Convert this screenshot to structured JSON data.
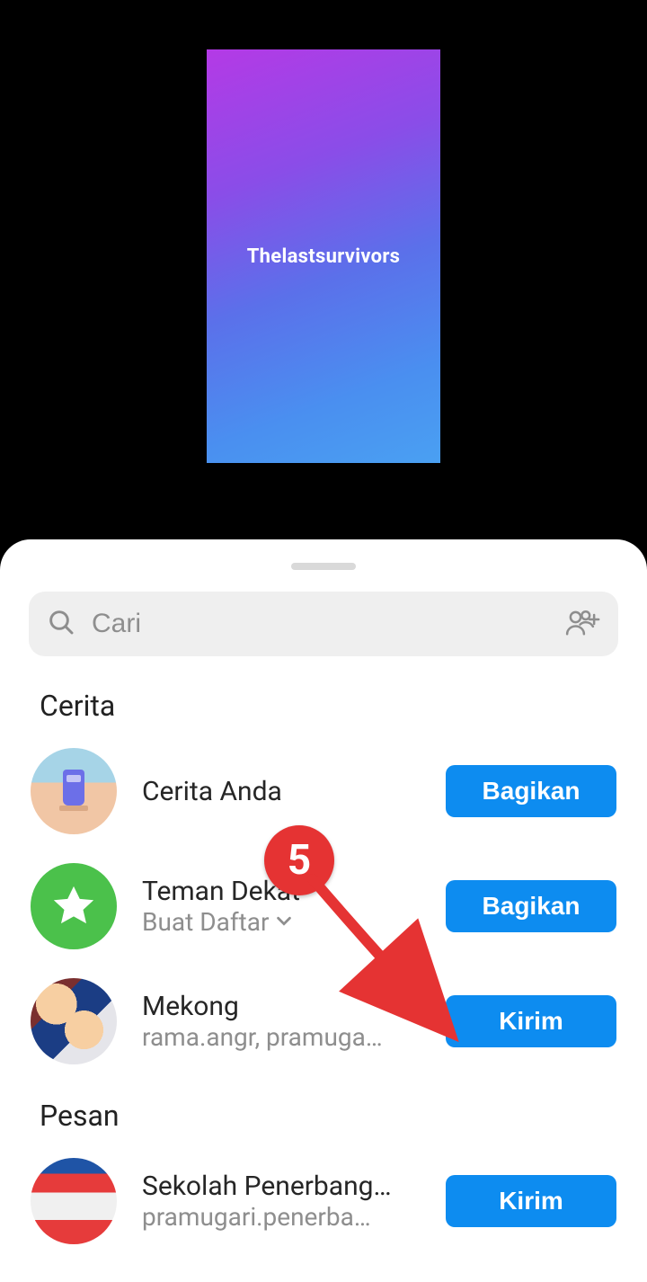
{
  "preview": {
    "text": "Thelastsurvivors"
  },
  "search": {
    "placeholder": "Cari"
  },
  "sections": {
    "cerita": "Cerita",
    "pesan": "Pesan"
  },
  "rows": {
    "your_story": {
      "title": "Cerita Anda",
      "action": "Bagikan"
    },
    "close_friends": {
      "title": "Teman Dekat",
      "subtitle": "Buat Daftar",
      "action": "Bagikan"
    },
    "mekong": {
      "title": "Mekong",
      "subtitle": "rama.angr, pramuga…",
      "action": "Kirim"
    },
    "sekolah": {
      "title": "Sekolah Penerbang…",
      "subtitle": "pramugari.penerba…",
      "action": "Kirim"
    }
  },
  "annotation": {
    "number": "5"
  }
}
